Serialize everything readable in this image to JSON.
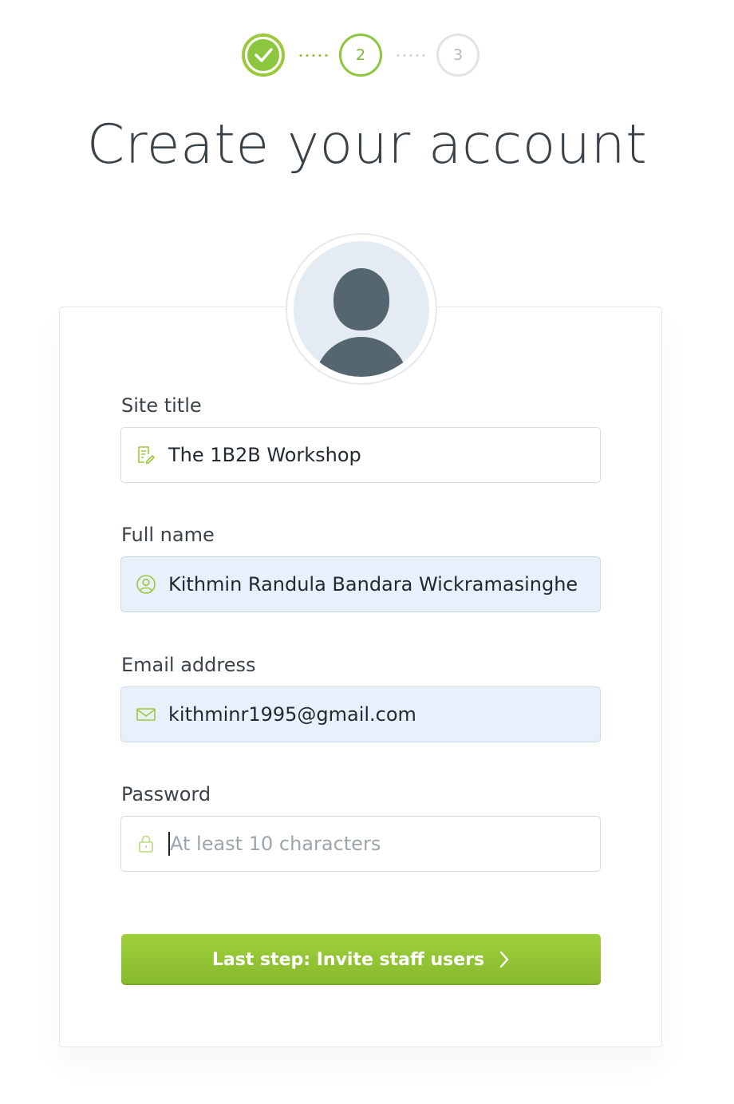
{
  "steps": {
    "current": "2",
    "future": "3"
  },
  "page_title": "Create your account",
  "form": {
    "site_title": {
      "label": "Site title",
      "value": "The 1B2B Workshop",
      "icon": "edit-icon"
    },
    "full_name": {
      "label": "Full name",
      "value": "Kithmin Randula Bandara Wickramasinghe",
      "icon": "user-icon"
    },
    "email": {
      "label": "Email address",
      "value": "kithminr1995@gmail.com",
      "icon": "mail-icon"
    },
    "password": {
      "label": "Password",
      "value": "",
      "placeholder": "At least 10 characters",
      "icon": "lock-icon"
    }
  },
  "submit": {
    "label": "Last step: Invite staff users",
    "icon": "chevron-right-icon"
  },
  "colors": {
    "accent": "#8cc63f",
    "text": "#3a424a",
    "field_fill": "#e8f0fb"
  }
}
